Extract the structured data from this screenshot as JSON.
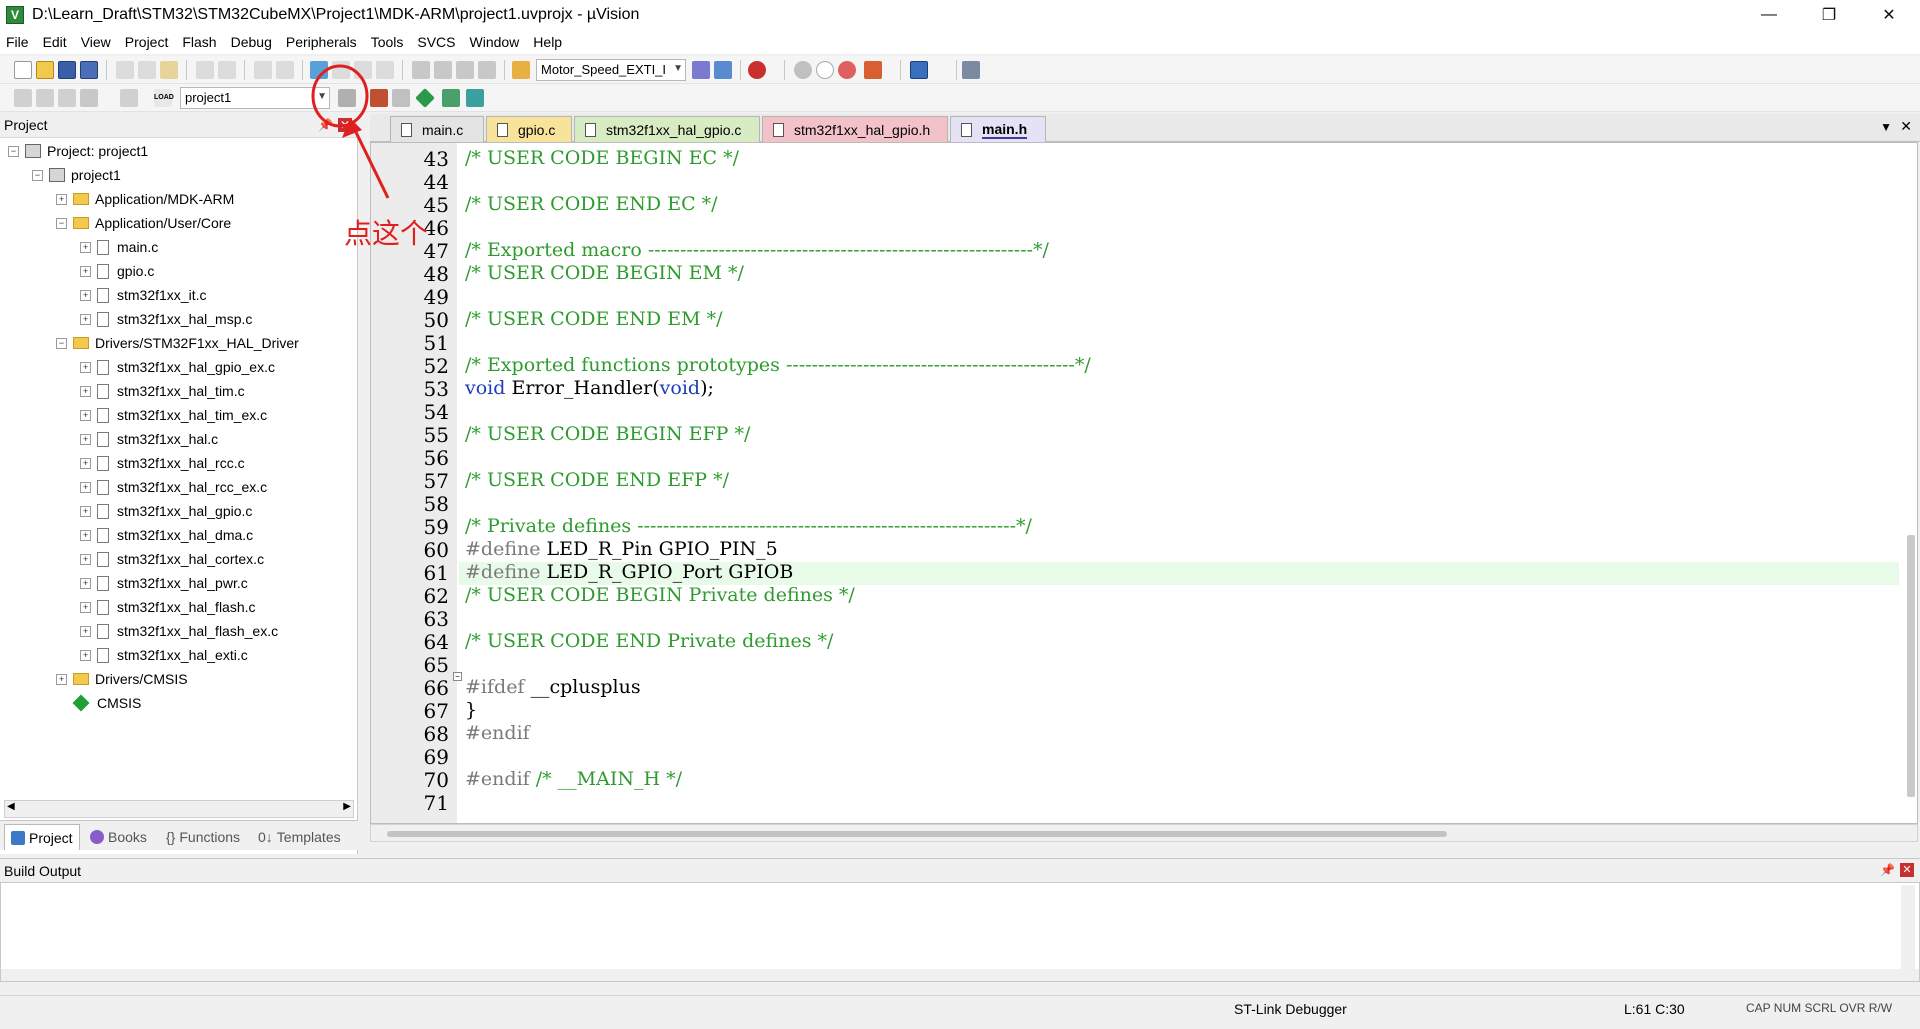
{
  "window": {
    "title": "D:\\Learn_Draft\\STM32\\STM32CubeMX\\Project1\\MDK-ARM\\project1.uvprojx - µVision",
    "app_icon": "V",
    "controls": [
      "—",
      "❐",
      "✕"
    ]
  },
  "menu": [
    "File",
    "Edit",
    "View",
    "Project",
    "Flash",
    "Debug",
    "Peripherals",
    "Tools",
    "SVCS",
    "Window",
    "Help"
  ],
  "toolbar": {
    "target_dropdown": "Motor_Speed_EXTI_I",
    "project_dropdown": "project1",
    "load_label": "LOAD"
  },
  "project_panel": {
    "title": "Project",
    "tree": [
      {
        "label": "Project: project1",
        "indent": 0,
        "kind": "proj",
        "exp": "−"
      },
      {
        "label": "project1",
        "indent": 1,
        "kind": "proj",
        "exp": "−"
      },
      {
        "label": "Application/MDK-ARM",
        "indent": 2,
        "kind": "folder",
        "exp": "+"
      },
      {
        "label": "Application/User/Core",
        "indent": 2,
        "kind": "folder",
        "exp": "−"
      },
      {
        "label": "main.c",
        "indent": 3,
        "kind": "file",
        "exp": "+"
      },
      {
        "label": "gpio.c",
        "indent": 3,
        "kind": "file",
        "exp": "+"
      },
      {
        "label": "stm32f1xx_it.c",
        "indent": 3,
        "kind": "file",
        "exp": "+"
      },
      {
        "label": "stm32f1xx_hal_msp.c",
        "indent": 3,
        "kind": "file",
        "exp": "+"
      },
      {
        "label": "Drivers/STM32F1xx_HAL_Driver",
        "indent": 2,
        "kind": "folder",
        "exp": "−"
      },
      {
        "label": "stm32f1xx_hal_gpio_ex.c",
        "indent": 3,
        "kind": "file",
        "exp": "+"
      },
      {
        "label": "stm32f1xx_hal_tim.c",
        "indent": 3,
        "kind": "file",
        "exp": "+"
      },
      {
        "label": "stm32f1xx_hal_tim_ex.c",
        "indent": 3,
        "kind": "file",
        "exp": "+"
      },
      {
        "label": "stm32f1xx_hal.c",
        "indent": 3,
        "kind": "file",
        "exp": "+"
      },
      {
        "label": "stm32f1xx_hal_rcc.c",
        "indent": 3,
        "kind": "file",
        "exp": "+"
      },
      {
        "label": "stm32f1xx_hal_rcc_ex.c",
        "indent": 3,
        "kind": "file",
        "exp": "+"
      },
      {
        "label": "stm32f1xx_hal_gpio.c",
        "indent": 3,
        "kind": "file",
        "exp": "+"
      },
      {
        "label": "stm32f1xx_hal_dma.c",
        "indent": 3,
        "kind": "file",
        "exp": "+"
      },
      {
        "label": "stm32f1xx_hal_cortex.c",
        "indent": 3,
        "kind": "file",
        "exp": "+"
      },
      {
        "label": "stm32f1xx_hal_pwr.c",
        "indent": 3,
        "kind": "file",
        "exp": "+"
      },
      {
        "label": "stm32f1xx_hal_flash.c",
        "indent": 3,
        "kind": "file",
        "exp": "+"
      },
      {
        "label": "stm32f1xx_hal_flash_ex.c",
        "indent": 3,
        "kind": "file",
        "exp": "+"
      },
      {
        "label": "stm32f1xx_hal_exti.c",
        "indent": 3,
        "kind": "file",
        "exp": "+"
      },
      {
        "label": "Drivers/CMSIS",
        "indent": 2,
        "kind": "folder",
        "exp": "+"
      },
      {
        "label": "CMSIS",
        "indent": 2,
        "kind": "gem",
        "exp": ""
      }
    ],
    "tabs": [
      {
        "label": "Project",
        "color": "#3c78c8"
      },
      {
        "label": "Books",
        "color": "#8a5cc8"
      },
      {
        "label": "Functions",
        "color": "#555555"
      },
      {
        "label": "Templates",
        "color": "#555555"
      }
    ]
  },
  "editor": {
    "tabs": [
      {
        "label": "main.c",
        "bg": "#e4e4e4",
        "active": false
      },
      {
        "label": "gpio.c",
        "bg": "#f7e39a",
        "active": false
      },
      {
        "label": "stm32f1xx_hal_gpio.c",
        "bg": "#d8ecc4",
        "active": false
      },
      {
        "label": "stm32f1xx_hal_gpio.h",
        "bg": "#f2c2c8",
        "active": false
      },
      {
        "label": "main.h",
        "bg": "#e6e2f6",
        "active": true
      }
    ],
    "current_line": 61,
    "lines": [
      {
        "n": "43",
        "parts": [
          {
            "t": "/* USER CODE BEGIN EC */",
            "c": "comment"
          }
        ]
      },
      {
        "n": "44",
        "parts": []
      },
      {
        "n": "45",
        "parts": [
          {
            "t": "/* USER CODE END EC */",
            "c": "comment"
          }
        ]
      },
      {
        "n": "46",
        "parts": []
      },
      {
        "n": "47",
        "parts": [
          {
            "t": "/* Exported macro ------------------------------------------------------------*/",
            "c": "comment"
          }
        ]
      },
      {
        "n": "48",
        "parts": [
          {
            "t": "/* USER CODE BEGIN EM */",
            "c": "comment"
          }
        ]
      },
      {
        "n": "49",
        "parts": []
      },
      {
        "n": "50",
        "parts": [
          {
            "t": "/* USER CODE END EM */",
            "c": "comment"
          }
        ]
      },
      {
        "n": "51",
        "parts": []
      },
      {
        "n": "52",
        "parts": [
          {
            "t": "/* Exported functions prototypes ---------------------------------------------*/",
            "c": "comment"
          }
        ]
      },
      {
        "n": "53",
        "parts": [
          {
            "t": "void",
            "c": "kw"
          },
          {
            "t": " Error_Handler(",
            "c": "txt"
          },
          {
            "t": "void",
            "c": "kw"
          },
          {
            "t": ");",
            "c": "txt"
          }
        ]
      },
      {
        "n": "54",
        "parts": []
      },
      {
        "n": "55",
        "parts": [
          {
            "t": "/* USER CODE BEGIN EFP */",
            "c": "comment"
          }
        ]
      },
      {
        "n": "56",
        "parts": []
      },
      {
        "n": "57",
        "parts": [
          {
            "t": "/* USER CODE END EFP */",
            "c": "comment"
          }
        ]
      },
      {
        "n": "58",
        "parts": []
      },
      {
        "n": "59",
        "parts": [
          {
            "t": "/* Private defines -----------------------------------------------------------*/",
            "c": "comment"
          }
        ]
      },
      {
        "n": "60",
        "parts": [
          {
            "t": "#define",
            "c": "pp"
          },
          {
            "t": " LED_R_Pin GPIO_PIN_5",
            "c": "txt"
          }
        ]
      },
      {
        "n": "61",
        "parts": [
          {
            "t": "#define",
            "c": "pp"
          },
          {
            "t": " LED_R_GPIO_Port GPIOB",
            "c": "txt"
          }
        ]
      },
      {
        "n": "62",
        "parts": [
          {
            "t": "/* USER CODE BEGIN Private defines */",
            "c": "comment"
          }
        ]
      },
      {
        "n": "63",
        "parts": []
      },
      {
        "n": "64",
        "parts": [
          {
            "t": "/* USER CODE END Private defines */",
            "c": "comment"
          }
        ]
      },
      {
        "n": "65",
        "parts": []
      },
      {
        "n": "66",
        "parts": [
          {
            "t": "#ifdef",
            "c": "pp"
          },
          {
            "t": " __cplusplus",
            "c": "txt"
          }
        ]
      },
      {
        "n": "67",
        "parts": [
          {
            "t": "}",
            "c": "txt"
          }
        ]
      },
      {
        "n": "68",
        "parts": [
          {
            "t": "#endif",
            "c": "pp"
          }
        ]
      },
      {
        "n": "69",
        "parts": []
      },
      {
        "n": "70",
        "parts": [
          {
            "t": "#endif",
            "c": "pp"
          },
          {
            "t": " /* __MAIN_H */",
            "c": "comment"
          }
        ]
      },
      {
        "n": "71",
        "parts": []
      }
    ]
  },
  "build_output": {
    "title": "Build Output"
  },
  "status": {
    "debugger": "ST-Link Debugger",
    "position": "L:61 C:30",
    "flags": "CAP NUM SCRL OVR R/W"
  },
  "annotation": {
    "text": "点这个",
    "color": "#e02020"
  }
}
